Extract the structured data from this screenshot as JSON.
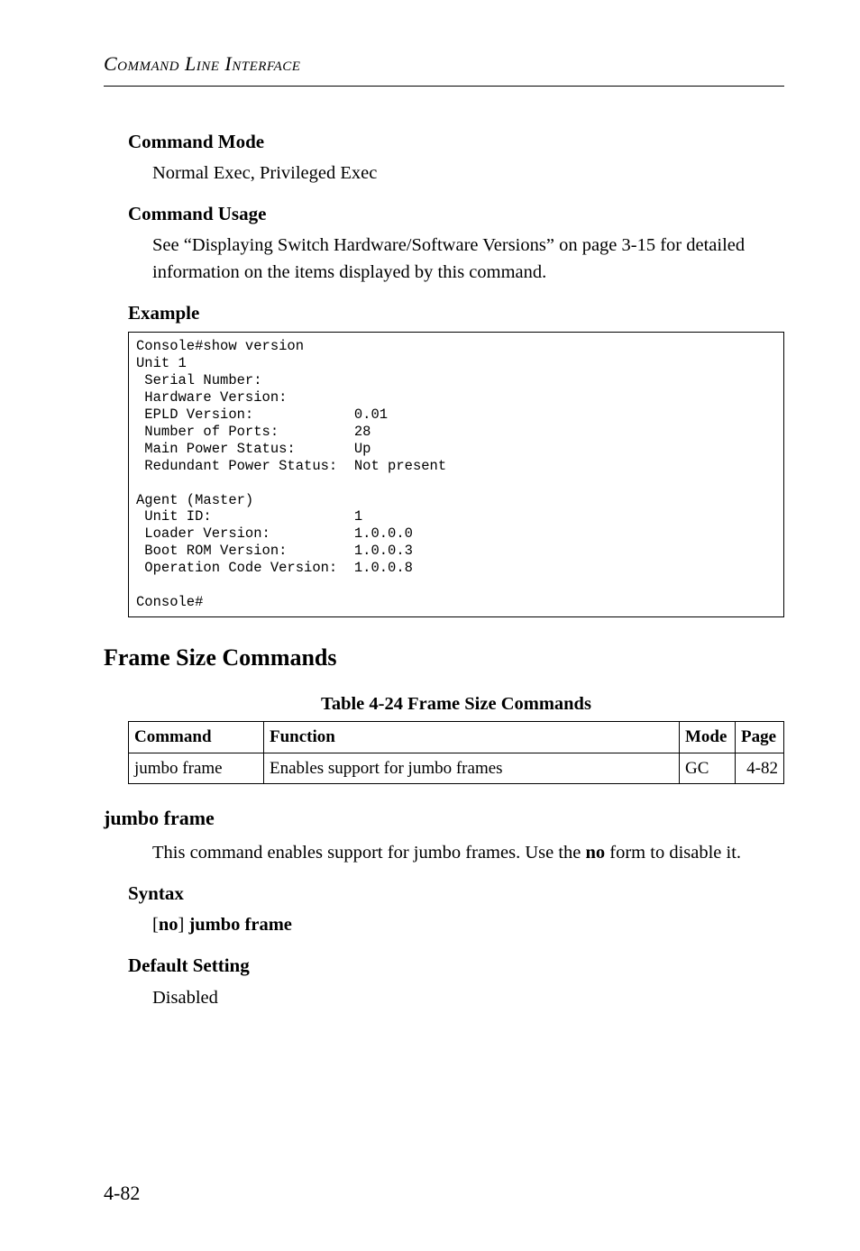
{
  "header": {
    "title": "Command Line Interface"
  },
  "sections": {
    "mode_title": "Command Mode",
    "mode_body": "Normal Exec, Privileged Exec",
    "usage_title": "Command Usage",
    "usage_body": "See “Displaying Switch Hardware/Software Versions” on page 3-15 for detailed information on the items displayed by this command.",
    "example_title": "Example"
  },
  "code": "Console#show version\nUnit 1\n Serial Number:\n Hardware Version:\n EPLD Version:            0.01\n Number of Ports:         28\n Main Power Status:       Up\n Redundant Power Status:  Not present\n\nAgent (Master)\n Unit ID:                 1\n Loader Version:          1.0.0.0\n Boot ROM Version:        1.0.0.3\n Operation Code Version:  1.0.0.8\n\nConsole#",
  "frame": {
    "heading": "Frame Size Commands",
    "table_caption": "Table 4-24  Frame Size Commands",
    "cols": {
      "c1": "Command",
      "c2": "Function",
      "c3": "Mode",
      "c4": "Page"
    },
    "row": {
      "c1": "jumbo frame",
      "c2": "Enables support for jumbo frames",
      "c3": "GC",
      "c4": "4-82"
    }
  },
  "jumbo": {
    "heading": "jumbo frame",
    "desc_pre": "This command enables support for jumbo frames. Use the ",
    "desc_bold": "no",
    "desc_post": " form to disable it.",
    "syntax_title": "Syntax",
    "syntax_line_pre": "[",
    "syntax_no": "no",
    "syntax_line_post": "] ",
    "syntax_cmd": "jumbo frame",
    "default_title": "Default Setting",
    "default_body": "Disabled"
  },
  "footer": {
    "page": "4-82"
  }
}
